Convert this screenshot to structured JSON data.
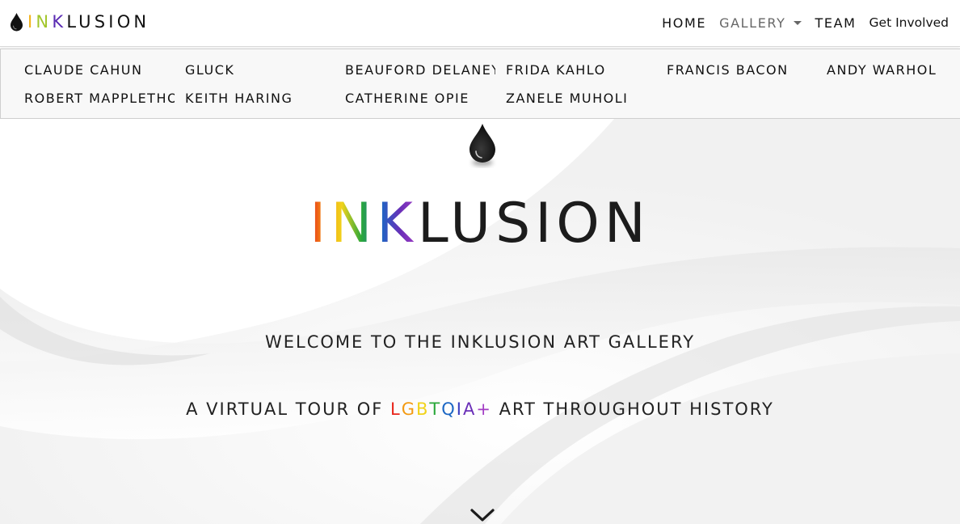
{
  "brand": {
    "name": "INKLUSION",
    "letters": [
      {
        "ch": "I",
        "color": "#f2b21a"
      },
      {
        "ch": "N",
        "color": "#a3c62c"
      },
      {
        "ch": "K",
        "color": "#5a2bb3"
      },
      {
        "ch": "L",
        "color": "#111111"
      },
      {
        "ch": "U",
        "color": "#111111"
      },
      {
        "ch": "S",
        "color": "#111111"
      },
      {
        "ch": "I",
        "color": "#111111"
      },
      {
        "ch": "O",
        "color": "#111111"
      },
      {
        "ch": "N",
        "color": "#111111"
      }
    ],
    "icon": "ink-drop-icon"
  },
  "nav": {
    "home": "HOME",
    "gallery": "GALLERY",
    "team": "TEAM",
    "get_involved": "Get Involved"
  },
  "gallery_menu": {
    "artists": [
      "CLAUDE CAHUN",
      "GLUCK",
      "BEAUFORD DELANEY",
      "FRIDA KAHLO",
      "FRANCIS BACON",
      "ANDY WARHOL",
      "ROBERT MAPPLETHORPE",
      "KEITH HARING",
      "CATHERINE OPIE",
      "ZANELE MUHOLI"
    ]
  },
  "hero": {
    "title_colored": "INK",
    "title_plain": "LUSION",
    "welcome": "WELCOME TO THE INKLUSION ART GALLERY",
    "tagline_prefix": "A VIRTUAL TOUR OF ",
    "tagline_rainbow": [
      {
        "ch": "L",
        "color": "#e8251b"
      },
      {
        "ch": "G",
        "color": "#f39a12"
      },
      {
        "ch": "B",
        "color": "#f1d31b"
      },
      {
        "ch": "T",
        "color": "#2aa83a"
      },
      {
        "ch": "Q",
        "color": "#1c67c4"
      },
      {
        "ch": "I",
        "color": "#3a3ec2"
      },
      {
        "ch": "A",
        "color": "#6a2fb8"
      },
      {
        "ch": "+",
        "color": "#a23cc4"
      }
    ],
    "tagline_suffix": " ART THROUGHOUT HISTORY",
    "scroll_icon": "chevron-down-icon"
  }
}
